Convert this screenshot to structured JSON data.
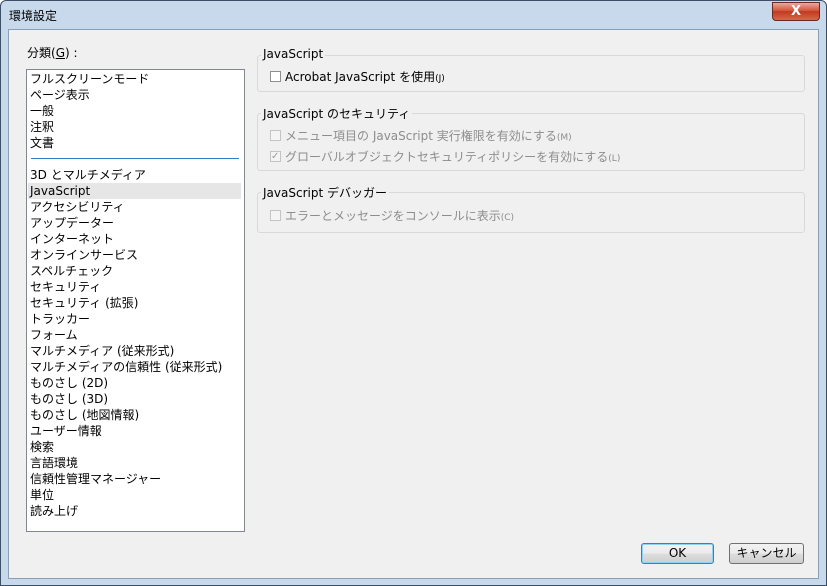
{
  "window": {
    "title": "環境設定",
    "close_label": "X"
  },
  "categories": {
    "label": "分類",
    "accel_key": "G",
    "label_suffix": " :",
    "top_items": [
      "フルスクリーンモード",
      "ページ表示",
      "一般",
      "注釈",
      "文書"
    ],
    "items": [
      "3D とマルチメディア",
      "JavaScript",
      "アクセシビリティ",
      "アップデーター",
      "インターネット",
      "オンラインサービス",
      "スペルチェック",
      "セキュリティ",
      "セキュリティ (拡張)",
      "トラッカー",
      "フォーム",
      "マルチメディア (従来形式)",
      "マルチメディアの信頼性 (従来形式)",
      "ものさし (2D)",
      "ものさし (3D)",
      "ものさし (地図情報)",
      "ユーザー情報",
      "検索",
      "言語環境",
      "信頼性管理マネージャー",
      "単位",
      "読み上げ"
    ],
    "selected": "JavaScript"
  },
  "javascript_group": {
    "title": "JavaScript",
    "enable_label": "Acrobat JavaScript を使用",
    "enable_accel": "(J)",
    "enable_checked": false
  },
  "security_group": {
    "title": "JavaScript のセキュリティ",
    "menu_exec_label": "メニュー項目の JavaScript 実行権限を有効にする",
    "menu_exec_accel": "(M)",
    "menu_exec_checked": false,
    "global_policy_label": "グローバルオブジェクトセキュリティポリシーを有効にする",
    "global_policy_accel": "(L)",
    "global_policy_checked": true
  },
  "debugger_group": {
    "title": "JavaScript デバッガー",
    "console_label": "エラーとメッセージをコンソールに表示",
    "console_accel": "(C)",
    "console_checked": false
  },
  "buttons": {
    "ok": "OK",
    "cancel": "キャンセル"
  }
}
